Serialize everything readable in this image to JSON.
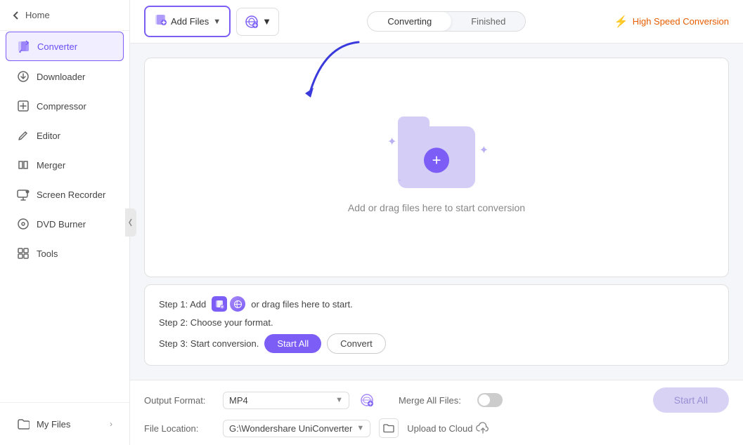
{
  "sidebar": {
    "back_label": "Home",
    "items": [
      {
        "id": "converter",
        "label": "Converter",
        "active": true
      },
      {
        "id": "downloader",
        "label": "Downloader",
        "active": false
      },
      {
        "id": "compressor",
        "label": "Compressor",
        "active": false
      },
      {
        "id": "editor",
        "label": "Editor",
        "active": false
      },
      {
        "id": "merger",
        "label": "Merger",
        "active": false
      },
      {
        "id": "screen-recorder",
        "label": "Screen Recorder",
        "active": false
      },
      {
        "id": "dvd-burner",
        "label": "DVD Burner",
        "active": false
      },
      {
        "id": "tools",
        "label": "Tools",
        "active": false
      }
    ],
    "my_files_label": "My Files"
  },
  "topbar": {
    "add_file_label": "Add Files",
    "add_url_label": "",
    "tabs": [
      {
        "id": "converting",
        "label": "Converting",
        "active": true
      },
      {
        "id": "finished",
        "label": "Finished",
        "active": false
      }
    ],
    "high_speed_label": "High Speed Conversion"
  },
  "dropzone": {
    "text": "Add or drag files here to start conversion"
  },
  "steps": [
    {
      "id": "step1",
      "text": "Step 1: Add",
      "suffix": "or drag files here to start."
    },
    {
      "id": "step2",
      "text": "Step 2: Choose your format."
    },
    {
      "id": "step3",
      "text": "Step 3: Start conversion.",
      "btn_start_all": "Start All",
      "btn_convert": "Convert"
    }
  ],
  "bottom": {
    "output_format_label": "Output Format:",
    "output_format_value": "MP4",
    "file_location_label": "File Location:",
    "file_location_value": "G:\\Wondershare UniConverter",
    "merge_label": "Merge All Files:",
    "upload_cloud_label": "Upload to Cloud",
    "start_all_label": "Start All"
  }
}
